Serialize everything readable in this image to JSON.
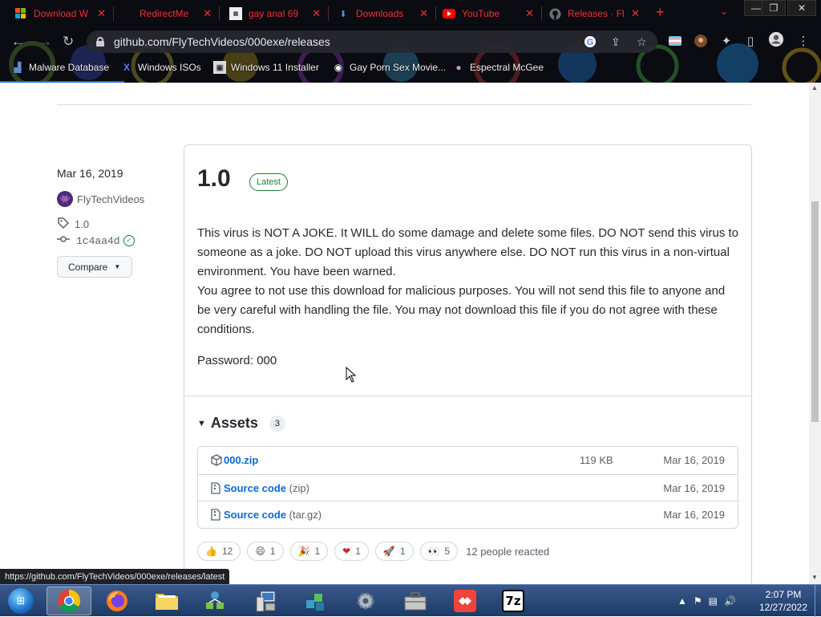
{
  "browser": {
    "tabs": [
      {
        "title": "Download W",
        "icon": "windows-logo-icon"
      },
      {
        "title": "RedirectMe",
        "icon": "redirect-icon"
      },
      {
        "title": "gay anal 69",
        "icon": "site-icon"
      },
      {
        "title": "Downloads",
        "icon": "download-icon"
      },
      {
        "title": "YouTube",
        "icon": "youtube-icon"
      },
      {
        "title": "Releases · Fl",
        "icon": "github-icon"
      }
    ],
    "new_tab": "+",
    "tab_menu": "⌄",
    "window_controls": {
      "minimize": "—",
      "restore": "❐",
      "close": "✕"
    },
    "url": "github.com/FlyTechVideos/000exe/releases",
    "bookmarks": [
      {
        "label": "Malware Database",
        "icon": "bookmark-icon"
      },
      {
        "label": "Windows ISOs",
        "icon": "x-icon"
      },
      {
        "label": "Windows 11 Installer",
        "icon": "image-icon"
      },
      {
        "label": "Gay Porn Sex Movie...",
        "icon": "site-icon"
      },
      {
        "label": "Espectral McGee",
        "icon": "site-icon"
      }
    ]
  },
  "release": {
    "date": "Mar 16, 2019",
    "author": "FlyTechVideos",
    "tag": "1.0",
    "commit": "1c4aa4d",
    "compare_label": "Compare",
    "title": "1.0",
    "badge": "Latest",
    "body_paragraph_1": "This virus is NOT A JOKE. It WILL do some damage and delete some files. DO NOT send this virus to someone as a joke. DO NOT upload this virus anywhere else. DO NOT run this virus in a non-virtual environment. You have been warned.",
    "body_paragraph_2": "You agree to not use this download for malicious purposes. You will not send this file to anyone and be very careful with handling the file. You may not download this file if you do not agree with these conditions.",
    "password": "Password: 000",
    "assets_heading": "Assets",
    "assets_count": "3",
    "assets": [
      {
        "name": "000.zip",
        "ext": "",
        "size": "119 KB",
        "date": "Mar 16, 2019",
        "icon": "package-icon"
      },
      {
        "name": "Source code",
        "ext": "(zip)",
        "size": "",
        "date": "Mar 16, 2019",
        "icon": "file-zip-icon"
      },
      {
        "name": "Source code",
        "ext": "(tar.gz)",
        "size": "",
        "date": "Mar 16, 2019",
        "icon": "file-zip-icon"
      }
    ],
    "reactions": [
      {
        "emoji": "👍",
        "count": "12",
        "icon": "thumbs-up-icon"
      },
      {
        "emoji": "😄",
        "count": "1",
        "icon": "laugh-icon"
      },
      {
        "emoji": "🎉",
        "count": "1",
        "icon": "hooray-icon"
      },
      {
        "emoji": "❤",
        "count": "1",
        "icon": "heart-icon"
      },
      {
        "emoji": "🚀",
        "count": "1",
        "icon": "rocket-icon"
      },
      {
        "emoji": "👀",
        "count": "5",
        "icon": "eyes-icon"
      }
    ],
    "reacted_text": "12 people reacted"
  },
  "status_link": "https://github.com/FlyTechVideos/000exe/releases/latest",
  "taskbar": {
    "apps": [
      {
        "label": "",
        "icon": "chrome-icon",
        "active": true
      },
      {
        "label": "",
        "icon": "firefox-icon",
        "active": false
      },
      {
        "label": "",
        "icon": "folder-icon",
        "active": false
      },
      {
        "label": "",
        "icon": "network-icon",
        "active": false
      },
      {
        "label": "",
        "icon": "computer-icon",
        "active": false
      },
      {
        "label": "",
        "icon": "cubes-icon",
        "active": false
      },
      {
        "label": "",
        "icon": "settings-icon",
        "active": false
      },
      {
        "label": "",
        "icon": "toolbox-icon",
        "active": false
      },
      {
        "label": "",
        "icon": "anydesk-icon",
        "active": false
      },
      {
        "label": "7z",
        "icon": "7zip-icon",
        "active": false
      }
    ],
    "time": "2:07 PM",
    "date": "12/27/2022"
  },
  "colors": {
    "link_blue": "#0969da",
    "latest_green": "#1a7f37",
    "chrome_dark": "#0c0c14",
    "tab_text_red": "#ee3333"
  }
}
